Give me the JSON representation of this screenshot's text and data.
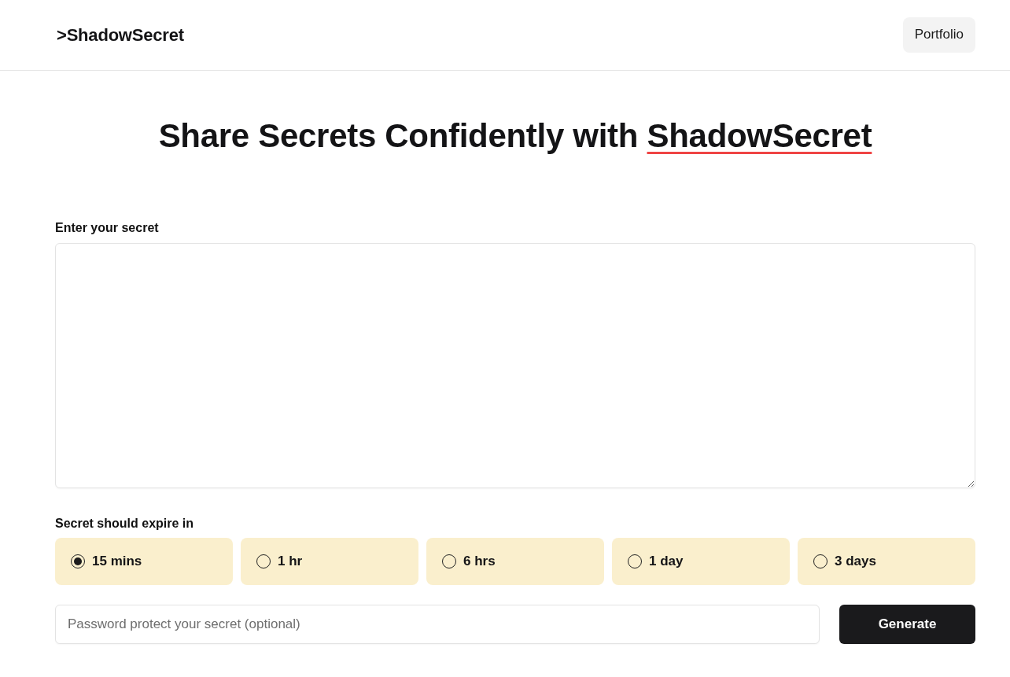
{
  "header": {
    "logo": ">ShadowSecret",
    "nav_button": "Portfolio"
  },
  "heading": {
    "text": "Share Secrets Confidently with",
    "highlight": "ShadowSecret"
  },
  "secret_field": {
    "label": "Enter your secret"
  },
  "expiry": {
    "label": "Secret should expire in",
    "options": [
      {
        "label": "15 mins",
        "selected": true
      },
      {
        "label": "1 hr",
        "selected": false
      },
      {
        "label": "6 hrs",
        "selected": false
      },
      {
        "label": "1 day",
        "selected": false
      },
      {
        "label": "3 days",
        "selected": false
      }
    ]
  },
  "password_field": {
    "placeholder": "Password protect your secret (optional)"
  },
  "generate_button": "Generate"
}
